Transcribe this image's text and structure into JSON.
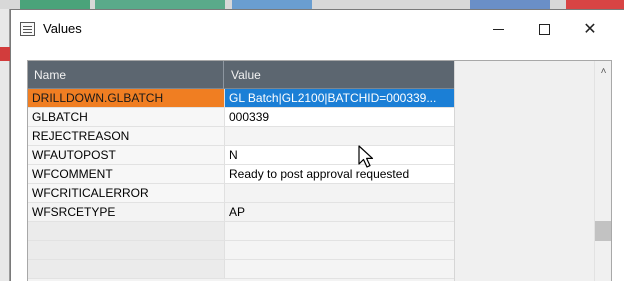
{
  "window": {
    "title": "Values",
    "icon": "window-form-icon",
    "controls": [
      "minimize-icon",
      "maximize-icon",
      "close-icon"
    ],
    "close_glyph": "✕"
  },
  "grid": {
    "columns": {
      "name": "Name",
      "value": "Value"
    },
    "rows": [
      {
        "name": "DRILLDOWN.GLBATCH",
        "value": "GL Batch|GL2100|BATCHID=000339...",
        "state": "selected"
      },
      {
        "name": "GLBATCH",
        "value": "000339"
      },
      {
        "name": "REJECTREASON",
        "value": ""
      },
      {
        "name": "WFAUTOPOST",
        "value": "N"
      },
      {
        "name": "WFCOMMENT",
        "value": "Ready to post approval requested"
      },
      {
        "name": "WFCRITICALERROR",
        "value": ""
      },
      {
        "name": "WFSRCETYPE",
        "value": "AP",
        "state": "highlighted"
      },
      {
        "name": "",
        "value": ""
      },
      {
        "name": "",
        "value": ""
      },
      {
        "name": "",
        "value": ""
      }
    ]
  },
  "scrollbar": {
    "up_glyph": "˄"
  },
  "colors": {
    "selected_name_bg": "#f07e22",
    "selected_value_bg": "#1b7fd6",
    "highlight": "#eaea1a",
    "header_bg": "#5c6670"
  }
}
